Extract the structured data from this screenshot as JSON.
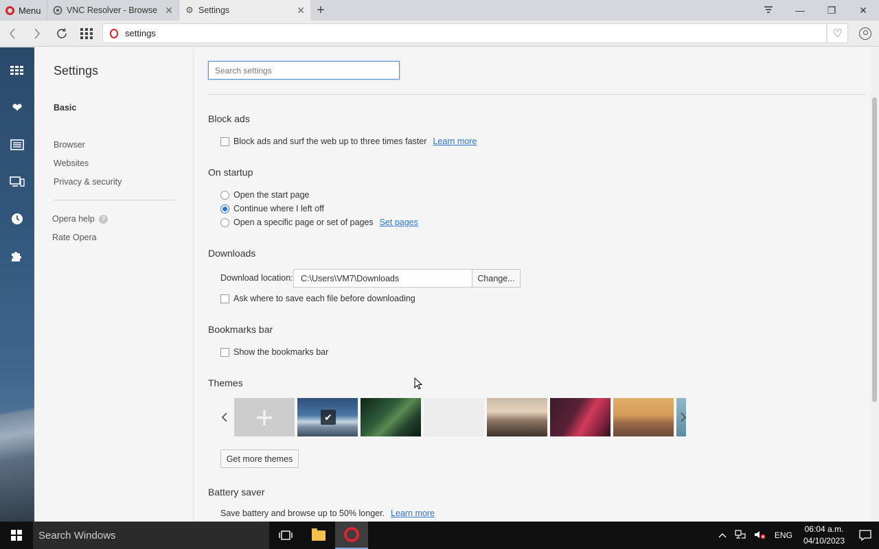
{
  "tabs": {
    "menu_label": "Menu",
    "items": [
      {
        "title": "VNC Resolver - Browse",
        "active": false
      },
      {
        "title": "Settings",
        "active": true
      }
    ]
  },
  "address": {
    "url": "settings"
  },
  "settings_nav": {
    "title": "Settings",
    "basic": "Basic",
    "browser": "Browser",
    "websites": "Websites",
    "privacy": "Privacy & security",
    "help": "Opera help",
    "rate": "Rate Opera"
  },
  "search": {
    "placeholder": "Search settings"
  },
  "block_ads": {
    "title": "Block ads",
    "checkbox_label": "Block ads and surf the web up to three times faster",
    "link": "Learn more",
    "checked": false
  },
  "startup": {
    "title": "On startup",
    "options": [
      {
        "label": "Open the start page",
        "checked": false
      },
      {
        "label": "Continue where I left off",
        "checked": true
      },
      {
        "label": "Open a specific page or set of pages",
        "checked": false,
        "link": "Set pages"
      }
    ]
  },
  "downloads": {
    "title": "Downloads",
    "location_label": "Download location:",
    "location_value": "C:\\Users\\VM7\\Downloads",
    "change_button": "Change...",
    "ask_label": "Ask where to save each file before downloading",
    "ask_checked": false
  },
  "bookmarks": {
    "title": "Bookmarks bar",
    "show_label": "Show the bookmarks bar",
    "checked": false
  },
  "themes": {
    "title": "Themes",
    "get_more_button": "Get more themes",
    "selected_index": 1
  },
  "battery": {
    "title": "Battery saver",
    "text": "Save battery and browse up to 50% longer.",
    "link": "Learn more"
  },
  "taskbar": {
    "search_placeholder": "Search Windows",
    "language": "ENG",
    "time": "06:04 a.m.",
    "date": "04/10/2023"
  },
  "colors": {
    "accent": "#2b73d4",
    "opera_red": "#d1232a"
  }
}
